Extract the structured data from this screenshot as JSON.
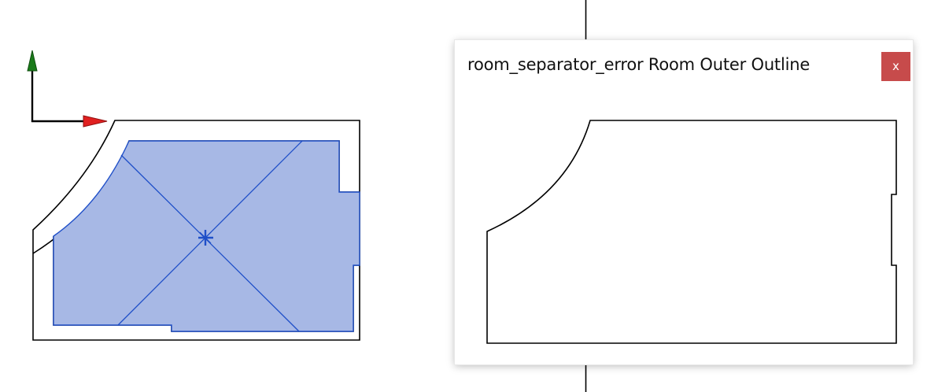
{
  "dialog": {
    "title": "room_separator_error Room Outer Outline",
    "close_label": "x"
  },
  "colors": {
    "room_fill": "#a7b8e5",
    "room_edge": "#1f4fc8",
    "wall_line": "#000000",
    "y_axis_arrow": "#1a7a1a",
    "x_axis_arrow": "#e02020",
    "close_button": "#c74b4b"
  }
}
